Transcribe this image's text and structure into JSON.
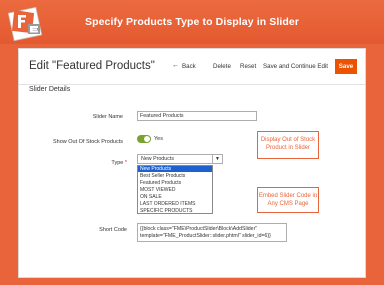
{
  "banner": {
    "title": "Specify Products Type to Display in Slider"
  },
  "header": {
    "title": "Edit \"Featured Products\"",
    "back_label": "Back",
    "delete_label": "Delete",
    "reset_label": "Reset",
    "save_continue_label": "Save and Continue Edit",
    "save_label": "Save"
  },
  "section": {
    "title": "Slider Details"
  },
  "form": {
    "slider_name_label": "Slider Name",
    "slider_name_value": "Featured Products",
    "out_of_stock_label": "Show Out Of Stock Products",
    "out_of_stock_value": "Yes",
    "type_label": "Type",
    "type_required": "*",
    "type_selected": "New Products",
    "type_options": [
      "New Products",
      "Best Seller Products",
      "Featured Products",
      "MOST VIEWED",
      "ON SALE",
      "LAST ORDERED ITEMS",
      "SPECIFIC PRODUCTS"
    ],
    "short_code_label": "Short Code",
    "short_code_value": "{{block class=\"FME\\ProductSlider\\Block\\AddSlider\" template=\"FME_ProductSlider::slider.phtml\" slider_id=6}}"
  },
  "callouts": {
    "out_of_stock": "Display Out of Stock Product in Slider",
    "embed": "Embed Slider Code in Any CMS Page"
  },
  "colors": {
    "accent": "#e9643a",
    "save": "#eb5202",
    "toggle": "#79a22e",
    "selected_option": "#1e61cd"
  }
}
